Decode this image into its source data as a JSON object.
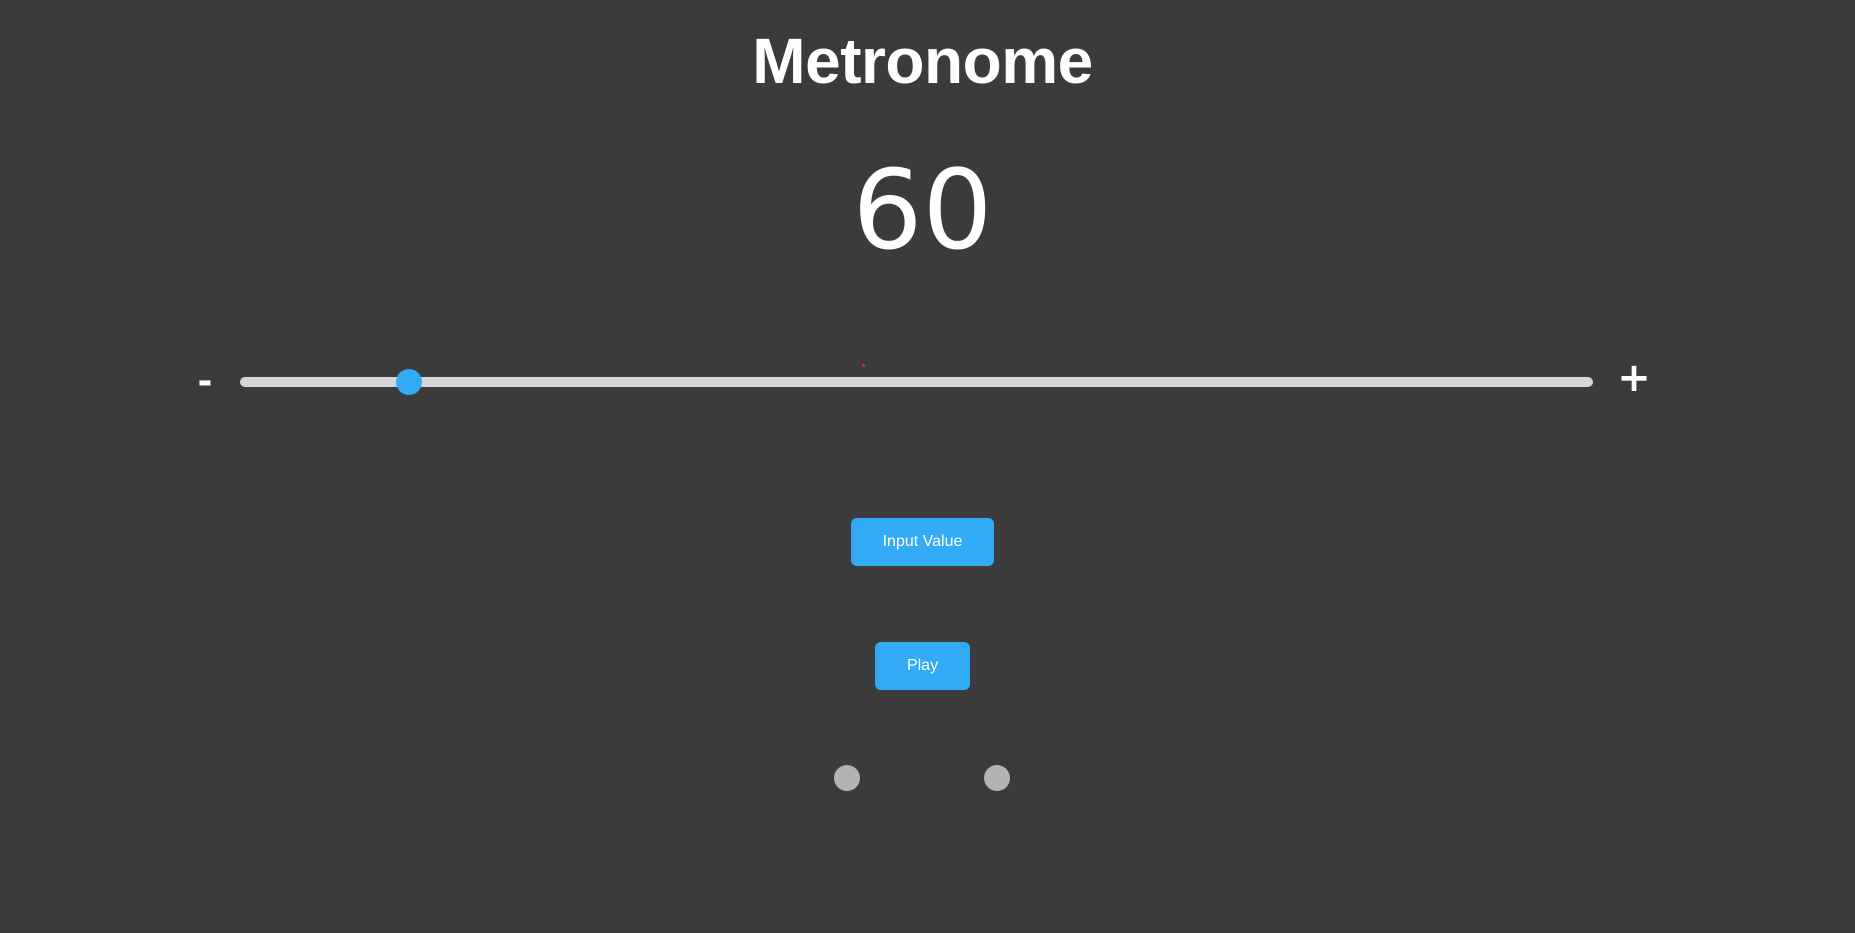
{
  "app": {
    "title": "Metronome"
  },
  "tempo": {
    "bpm": "60",
    "slider_fraction": 0.125
  },
  "controls": {
    "decrease_label": "-",
    "increase_label": "+",
    "input_value_label": "Input Value",
    "play_label": "Play"
  },
  "beats": {
    "count": 2,
    "color": "#b3b3b3"
  },
  "colors": {
    "background": "#3b3b3b",
    "accent": "#33aaf5",
    "track": "#d6d6d6",
    "text": "#ffffff"
  }
}
